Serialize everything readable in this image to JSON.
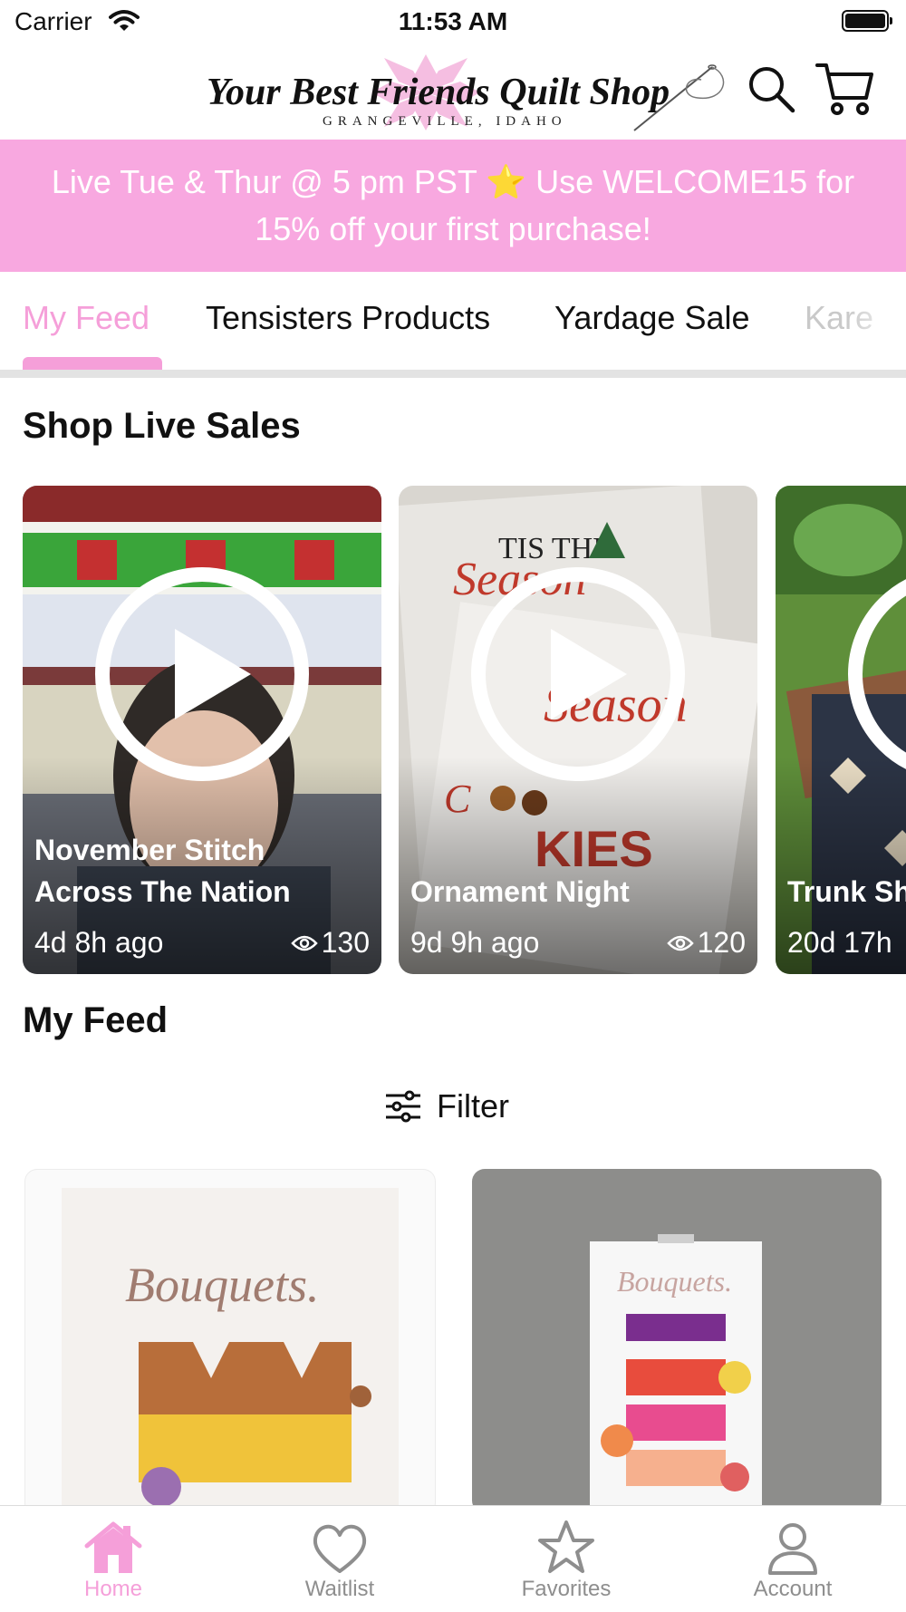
{
  "status_bar": {
    "carrier": "Carrier",
    "time": "11:53 AM"
  },
  "header": {
    "logo_title": "Your Best Friends Quilt Shop",
    "logo_subtitle": "GRANGEVILLE, IDAHO",
    "search_icon": "search-icon",
    "cart_icon": "cart-icon"
  },
  "promo": {
    "text": "Live Tue & Thur @ 5 pm PST ⭐ Use WELCOME15 for 15% off your first purchase!"
  },
  "tabs": [
    {
      "label": "My Feed",
      "active": true
    },
    {
      "label": "Tensisters Products",
      "active": false
    },
    {
      "label": "Yardage Sale",
      "active": false
    },
    {
      "label": "Kare",
      "active": false
    }
  ],
  "live_sales": {
    "title": "Shop Live Sales",
    "cards": [
      {
        "title": "November Stitch Across The Nation",
        "age": "4d 8h ago",
        "views": "130"
      },
      {
        "title": "Ornament Night",
        "age": "9d 9h ago",
        "views": "120"
      },
      {
        "title": "Trunk Sh Karen W",
        "age": "20d 17h",
        "views": ""
      }
    ]
  },
  "feed": {
    "title": "My Feed",
    "filter_label": "Filter",
    "products": [
      {
        "image_text": "Bouquets."
      },
      {
        "image_text": "Bouquets."
      }
    ]
  },
  "tab_bar": {
    "items": [
      {
        "label": "Home",
        "icon": "home-icon",
        "active": true
      },
      {
        "label": "Waitlist",
        "icon": "heart-icon",
        "active": false
      },
      {
        "label": "Favorites",
        "icon": "star-icon",
        "active": false
      },
      {
        "label": "Account",
        "icon": "person-icon",
        "active": false
      }
    ]
  },
  "colors": {
    "accent_pink": "#f59fd9",
    "promo_bg": "#f8a8e0",
    "inactive_gray": "#8e8e8e"
  }
}
